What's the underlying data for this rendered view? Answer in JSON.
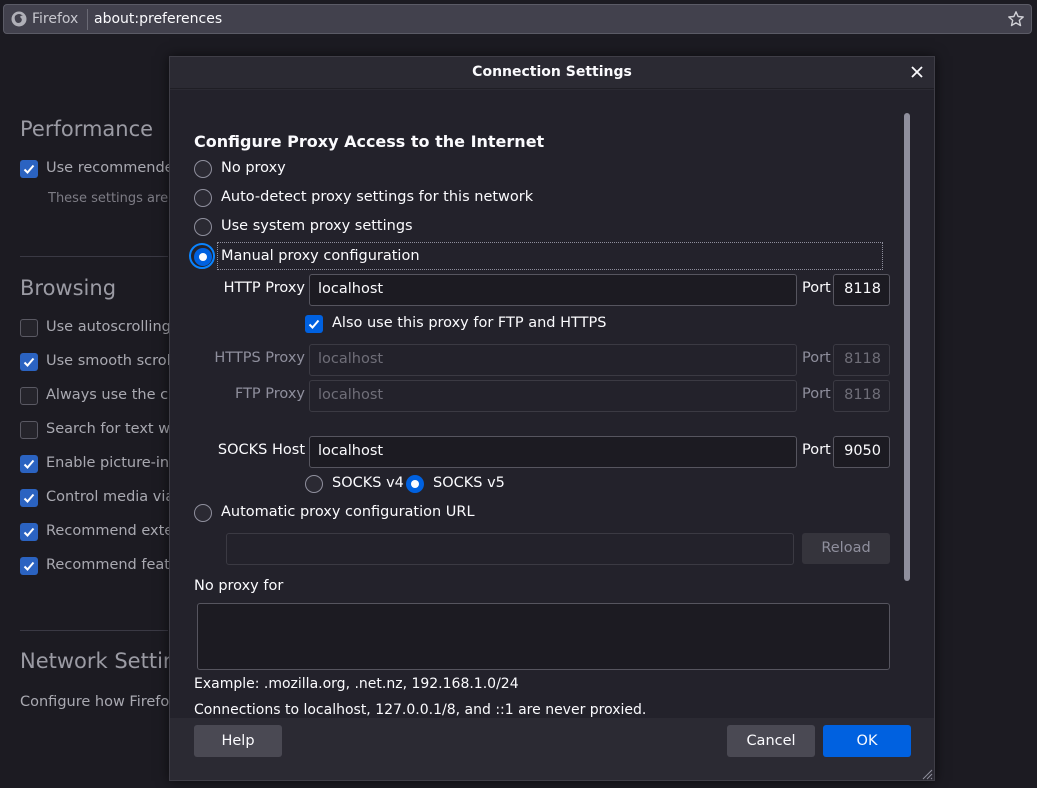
{
  "browser": {
    "app_name": "Firefox",
    "url": "about:preferences"
  },
  "background": {
    "performance_heading": "Performance",
    "use_recommended_label": "Use recommende",
    "settings_note": "These settings are t",
    "browsing_heading": "Browsing",
    "browsing_items": [
      {
        "label": "Use autoscrolling",
        "checked": false
      },
      {
        "label": "Use smooth scroll",
        "checked": true
      },
      {
        "label": "Always use the cu",
        "checked": false
      },
      {
        "label": "Search for text wh",
        "checked": false
      },
      {
        "label": "Enable picture-in-",
        "checked": true
      },
      {
        "label": "Control media via",
        "checked": true
      },
      {
        "label": "Recommend exte",
        "checked": true
      },
      {
        "label": "Recommend featu",
        "checked": true
      }
    ],
    "network_heading": "Network Setting",
    "network_description": "Configure how Firefox"
  },
  "dialog": {
    "title": "Connection Settings",
    "section_title": "Configure Proxy Access to the Internet",
    "options": {
      "no_proxy": "No proxy",
      "auto_detect": "Auto-detect proxy settings for this network",
      "system": "Use system proxy settings",
      "manual": "Manual proxy configuration",
      "auto_url": "Automatic proxy configuration URL"
    },
    "selected_option": "manual",
    "http": {
      "label": "HTTP Proxy",
      "value": "localhost",
      "port_label": "Port",
      "port": "8118"
    },
    "also_use_label": "Also use this proxy for FTP and HTTPS",
    "also_use_checked": true,
    "https": {
      "label": "HTTPS Proxy",
      "value": "localhost",
      "port_label": "Port",
      "port": "8118"
    },
    "ftp": {
      "label": "FTP Proxy",
      "value": "localhost",
      "port_label": "Port",
      "port": "8118"
    },
    "socks": {
      "label": "SOCKS Host",
      "value": "localhost",
      "port_label": "Port",
      "port": "9050"
    },
    "socks_v4": "SOCKS v4",
    "socks_v5": "SOCKS v5",
    "socks_selected": "v5",
    "auto_url_value": "",
    "reload_label": "Reload",
    "no_proxy_for_label": "No proxy for",
    "no_proxy_for_value": "",
    "example_note": "Example: .mozilla.org, .net.nz, 192.168.1.0/24",
    "localhost_note": "Connections to localhost, 127.0.0.1/8, and ::1 are never proxied.",
    "help_label": "Help",
    "cancel_label": "Cancel",
    "ok_label": "OK"
  },
  "colors": {
    "accent": "#0061e0",
    "page_bg": "#1c1b22",
    "dialog_bg": "#23222b"
  }
}
